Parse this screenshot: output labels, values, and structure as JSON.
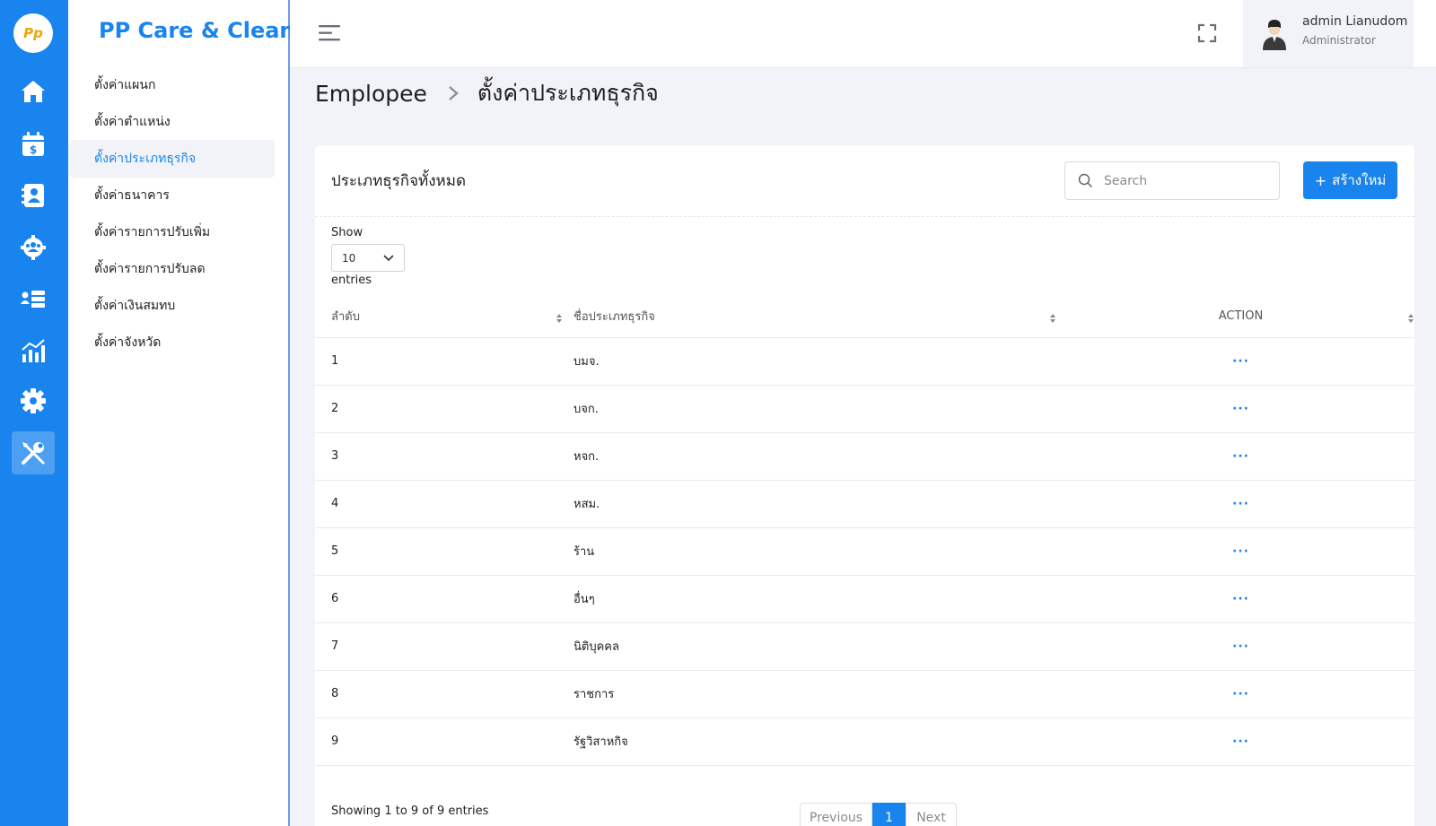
{
  "app": {
    "logo_text": "Pp",
    "brand": "PP Care & Clean",
    "accent_color": "#1a84ee"
  },
  "rail": {
    "icons": [
      "home-icon",
      "calendar-dollar-icon",
      "contacts-icon",
      "team-gear-icon",
      "user-list-icon",
      "chart-icon",
      "gear-icon",
      "tools-icon"
    ],
    "active_index": 7
  },
  "subnav": {
    "items": [
      {
        "label": "ตั้งค่าแผนก"
      },
      {
        "label": "ตั้งค่าตำแหน่ง"
      },
      {
        "label": "ตั้งค่าประเภทธุรกิจ"
      },
      {
        "label": "ตั้งค่าธนาคาร"
      },
      {
        "label": "ตั้งค่ารายการปรับเพิ่ม"
      },
      {
        "label": "ตั้งค่ารายการปรับลด"
      },
      {
        "label": "ตั้งค่าเงินสมทบ"
      },
      {
        "label": "ตั้งค่าจังหวัด"
      }
    ],
    "active_index": 2
  },
  "topbar": {
    "user_name": "admin Lianudom",
    "user_role": "Administrator"
  },
  "breadcrumb": {
    "root": "Emplopee",
    "current": "ตั้งค่าประเภทธุรกิจ"
  },
  "card": {
    "title": "ประเภทธุรกิจทั้งหมด",
    "search_placeholder": "Search",
    "create_label": "สร้างใหม่",
    "length_label_before": "Show",
    "length_value": "10",
    "length_label_after": "entries"
  },
  "table": {
    "columns": [
      "ลำดับ",
      "ชื่อประเภทธุรกิจ",
      "ACTION"
    ],
    "rows": [
      {
        "no": "1",
        "name": "บมจ.",
        "action": "···"
      },
      {
        "no": "2",
        "name": "บจก.",
        "action": "···"
      },
      {
        "no": "3",
        "name": "หจก.",
        "action": "···"
      },
      {
        "no": "4",
        "name": "หสม.",
        "action": "···"
      },
      {
        "no": "5",
        "name": "ร้าน",
        "action": "···"
      },
      {
        "no": "6",
        "name": "อื่นๆ",
        "action": "···"
      },
      {
        "no": "7",
        "name": "นิติบุคคล",
        "action": "···"
      },
      {
        "no": "8",
        "name": "ราชการ",
        "action": "···"
      },
      {
        "no": "9",
        "name": "รัฐวิสาหกิจ",
        "action": "···"
      }
    ]
  },
  "footer": {
    "info": "Showing 1 to 9 of 9 entries",
    "previous": "Previous",
    "current_page": "1",
    "next": "Next"
  }
}
